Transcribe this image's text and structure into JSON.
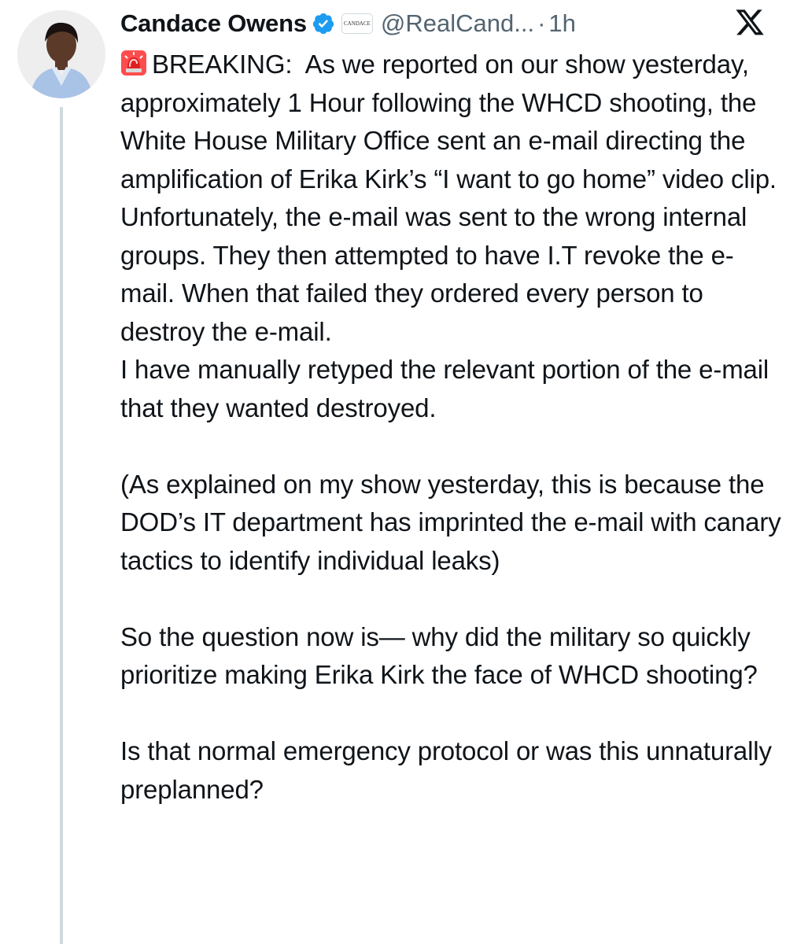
{
  "tweet": {
    "author": {
      "display_name": "Candace Owens",
      "handle": "@RealCand...",
      "verified_icon": "verified-badge-icon",
      "affiliation_badge_text": "CANDACE",
      "avatar": "profile-avatar"
    },
    "separator": "·",
    "timestamp": "1h",
    "platform_icon": "x-logo-icon",
    "breaking_emoji": "police-siren-icon",
    "body_text": "BREAKING:  As we reported on our show yesterday, approximately 1 Hour following the WHCD shooting, the White House Military Office sent an e-mail directing the amplification of Erika Kirk’s “I want to go home” video clip. Unfortunately, the e-mail was sent to the wrong internal groups. They then attempted to have I.T revoke the e-mail. When that failed they ordered every person to destroy the e-mail.\nI have manually retyped the relevant portion of the e-mail that they wanted destroyed.\n\n(As explained on my show yesterday, this is because the DOD’s IT department has imprinted the e-mail with canary tactics to identify individual leaks)\n\nSo the question now is— why did the military so quickly prioritize making Erika Kirk the face of WHCD shooting?\n\nIs that normal emergency protocol or was this unnaturally preplanned?"
  },
  "colors": {
    "text": "#0f1419",
    "secondary_text": "#536471",
    "verified_blue": "#1d9bf0",
    "thread_line": "#cfd9de"
  }
}
